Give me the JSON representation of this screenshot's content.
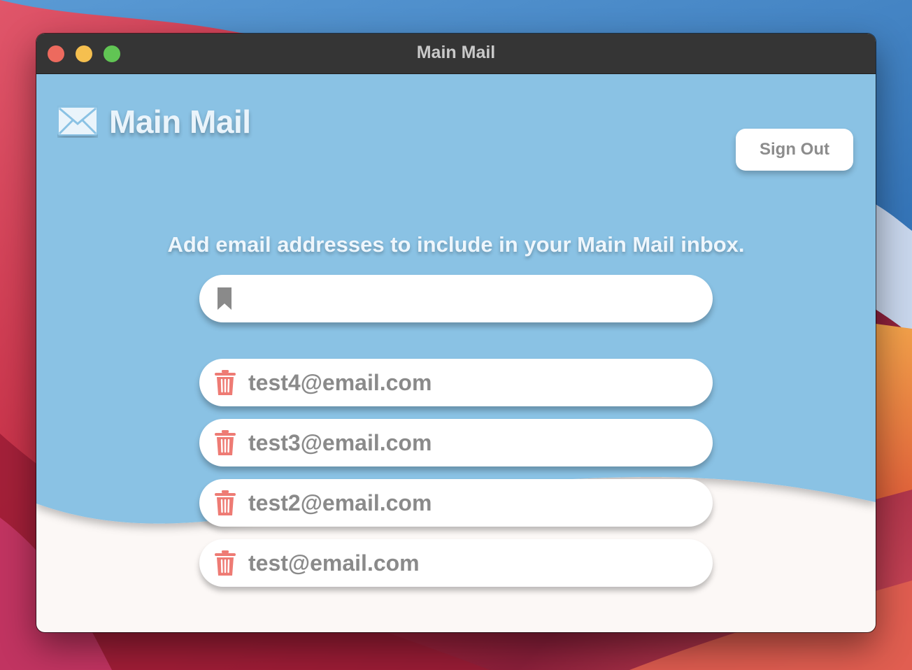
{
  "window": {
    "title": "Main Mail"
  },
  "header": {
    "brand_title": "Main Mail",
    "brand_icon": "envelope-icon",
    "sign_out_label": "Sign Out"
  },
  "main": {
    "instructions": "Add email addresses to include in your Main Mail inbox.",
    "new_email": {
      "value": "",
      "placeholder": "",
      "icon": "bookmark-icon"
    },
    "emails": [
      {
        "address": "test4@email.com",
        "delete_icon": "trash-icon"
      },
      {
        "address": "test3@email.com",
        "delete_icon": "trash-icon"
      },
      {
        "address": "test2@email.com",
        "delete_icon": "trash-icon"
      },
      {
        "address": "test@email.com",
        "delete_icon": "trash-icon"
      }
    ]
  },
  "colors": {
    "header_blue": "#8ac2e4",
    "background": "#fcf8f6",
    "trash_red": "#ee7b74",
    "title_bar": "#353535"
  }
}
